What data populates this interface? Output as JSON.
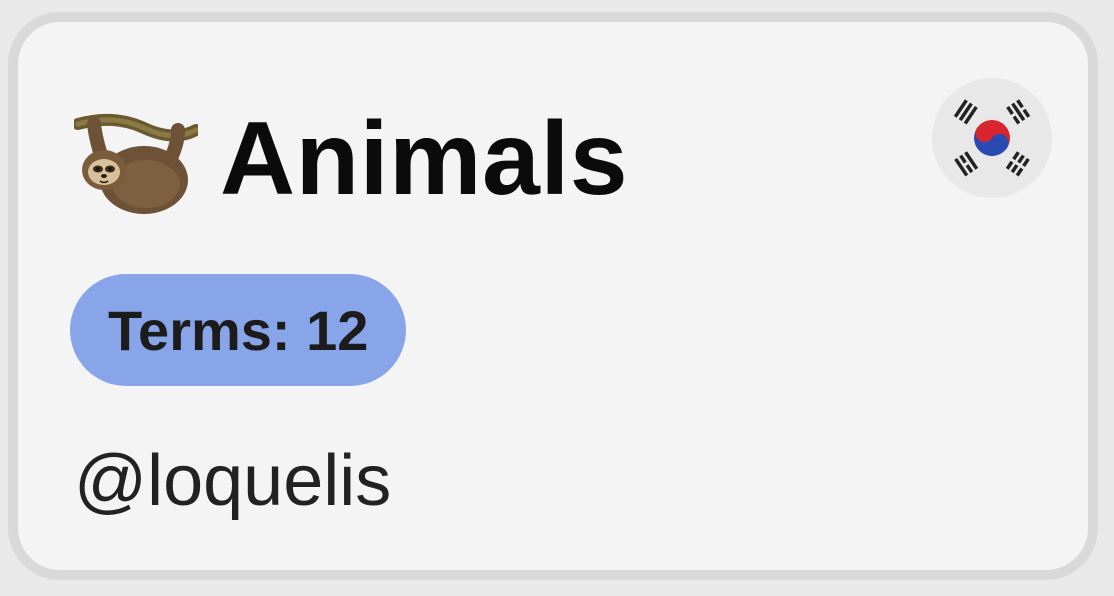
{
  "card": {
    "title": "Animals",
    "title_icon": "sloth-icon",
    "language_flag": "south-korea-flag-icon",
    "terms_label": "Terms: 12",
    "author": "@loquelis"
  },
  "colors": {
    "card_background": "#f4f4f4",
    "card_border": "#d9d9d9",
    "badge_background": "#89a5ea",
    "title_text": "#0b0b0b"
  }
}
